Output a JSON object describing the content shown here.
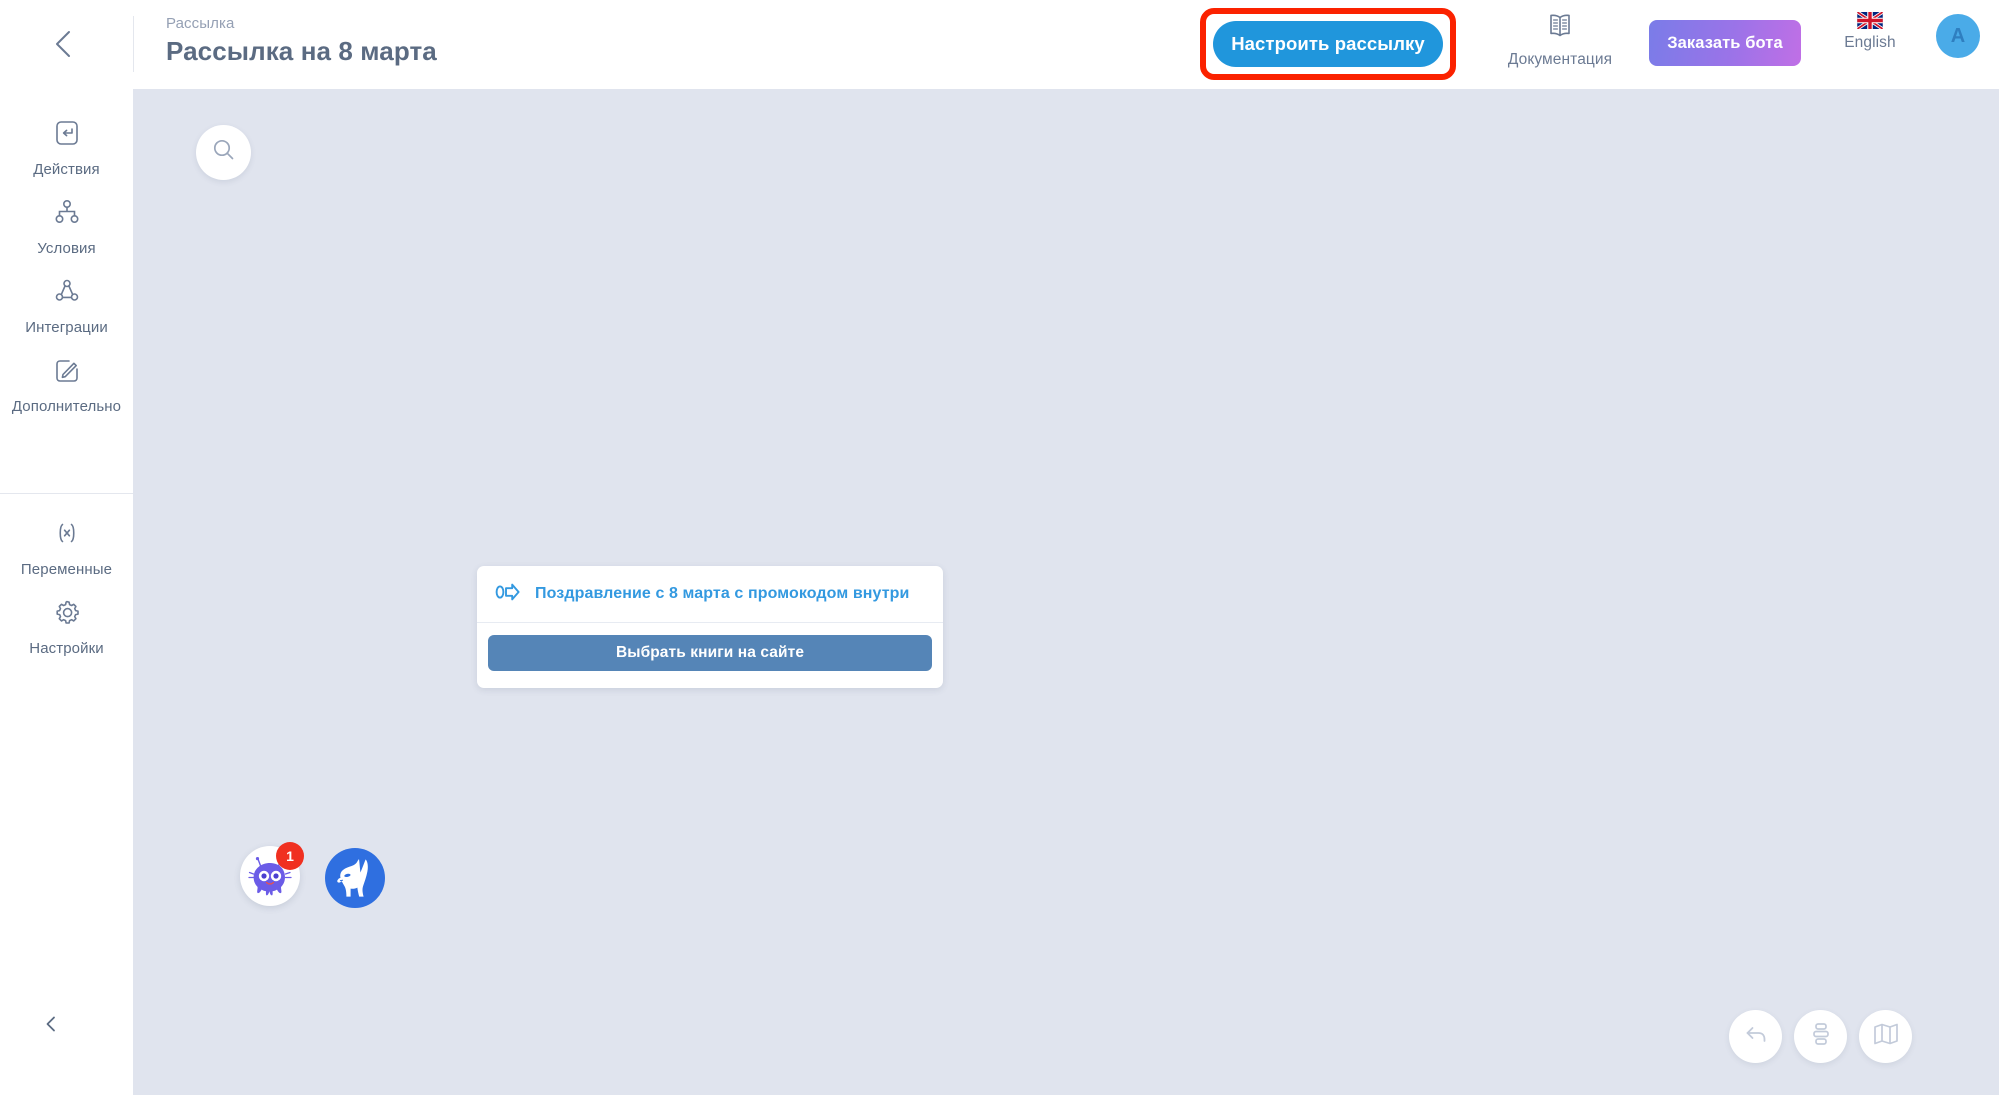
{
  "header": {
    "back_icon": "chevron-left-icon",
    "breadcrumb": "Рассылка",
    "title": "Рассылка на 8 марта",
    "setup_button": "Настроить рассылку",
    "documentation_label": "Документация",
    "documentation_icon": "book-icon",
    "order_bot_button": "Заказать бота",
    "language_label": "English",
    "language_icon": "uk-flag-icon",
    "avatar_initial": "A"
  },
  "sidebar": {
    "top_items": [
      {
        "label": "Действия",
        "icon": "enter-arrow-icon"
      },
      {
        "label": "Условия",
        "icon": "branch-tree-icon"
      },
      {
        "label": "Интеграции",
        "icon": "share-nodes-icon"
      },
      {
        "label": "Дополнительно",
        "icon": "pencil-square-icon"
      }
    ],
    "bottom_items": [
      {
        "label": "Переменные",
        "icon": "variable-brackets-icon"
      },
      {
        "label": "Настройки",
        "icon": "gear-icon"
      }
    ],
    "collapse_icon": "chevron-left-icon"
  },
  "canvas": {
    "search_icon": "search-icon",
    "card": {
      "flow_icon": "message-flow-icon",
      "title": "Поздравление с 8 марта с промокодом внутри",
      "button_label": "Выбрать книги на сайте"
    },
    "bot_avatars": [
      {
        "name": "octopus-bot-avatar",
        "badge": "1"
      },
      {
        "name": "llama-bot-avatar",
        "badge": ""
      }
    ],
    "tools": [
      {
        "name": "undo-button",
        "icon": "undo-arrow-icon"
      },
      {
        "name": "auto-arrange-button",
        "icon": "stacked-blocks-icon"
      },
      {
        "name": "map-overview-button",
        "icon": "folded-map-icon"
      }
    ]
  },
  "colors": {
    "accent_blue": "#2096dc",
    "annotation_red": "#fb2200",
    "canvas_bg": "#e0e4ee",
    "card_title_blue": "#3399e0",
    "card_button_blue": "#5585b7",
    "badge_red": "#f03020"
  }
}
